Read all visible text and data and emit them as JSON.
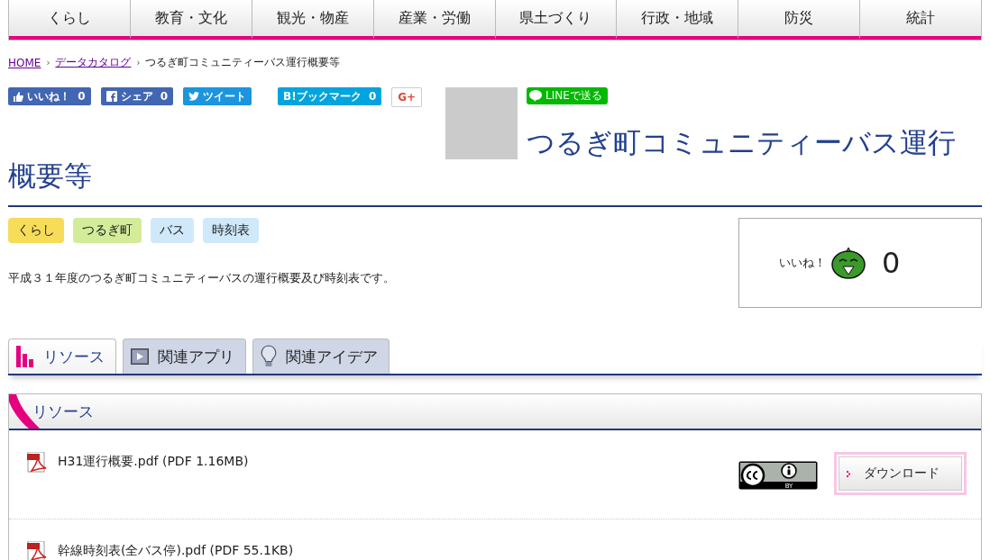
{
  "nav": {
    "items": [
      {
        "label": "くらし"
      },
      {
        "label": "教育・文化"
      },
      {
        "label": "観光・物産"
      },
      {
        "label": "産業・労働"
      },
      {
        "label": "県土づくり"
      },
      {
        "label": "行政・地域"
      },
      {
        "label": "防災"
      },
      {
        "label": "統計"
      }
    ]
  },
  "breadcrumb_separator": "›",
  "breadcrumb": [
    {
      "label": "HOME",
      "kind": "link"
    },
    {
      "label": "データカタログ",
      "kind": "link"
    },
    {
      "label": "つるぎ町コミュニティーバス運行概要等",
      "kind": "current"
    }
  ],
  "share_buttons": [
    {
      "kind": "like",
      "label": "いいね！",
      "count": "0"
    },
    {
      "kind": "share",
      "label": "シェア",
      "count": "0"
    },
    {
      "kind": "tweet",
      "label": "ツイート"
    },
    {
      "kind": "bookmark",
      "label": "B!ブックマーク",
      "count": "0"
    },
    {
      "kind": "plus",
      "label": "G+"
    }
  ],
  "line_button": {
    "label": "LINEで送る"
  },
  "title": "つるぎ町コミュニティーバス運行概要等",
  "tags": [
    {
      "label": "くらし",
      "color": "#f7dc5a"
    },
    {
      "label": "つるぎ町",
      "color": "#d3ec9a"
    },
    {
      "label": "バス",
      "color": "#cfe9fb"
    },
    {
      "label": "時刻表",
      "color": "#cfe9fb"
    }
  ],
  "description": "平成３１年度のつるぎ町コミュニティーバスの運行概要及び時刻表です。",
  "like_box": {
    "label": "いいね！",
    "count": "0"
  },
  "tabs": [
    {
      "label": "リソース",
      "selected": true
    },
    {
      "label": "関連アプリ",
      "selected": false
    },
    {
      "label": "関連アイデア",
      "selected": false
    }
  ],
  "resources": {
    "title": "リソース",
    "items": [
      {
        "name": "H31運行概要.pdf (PDF 1.16MB)",
        "license": "BY",
        "download": "ダウンロード"
      },
      {
        "name": "幹線時刻表(全バス停).pdf (PDF 55.1KB)"
      }
    ]
  }
}
